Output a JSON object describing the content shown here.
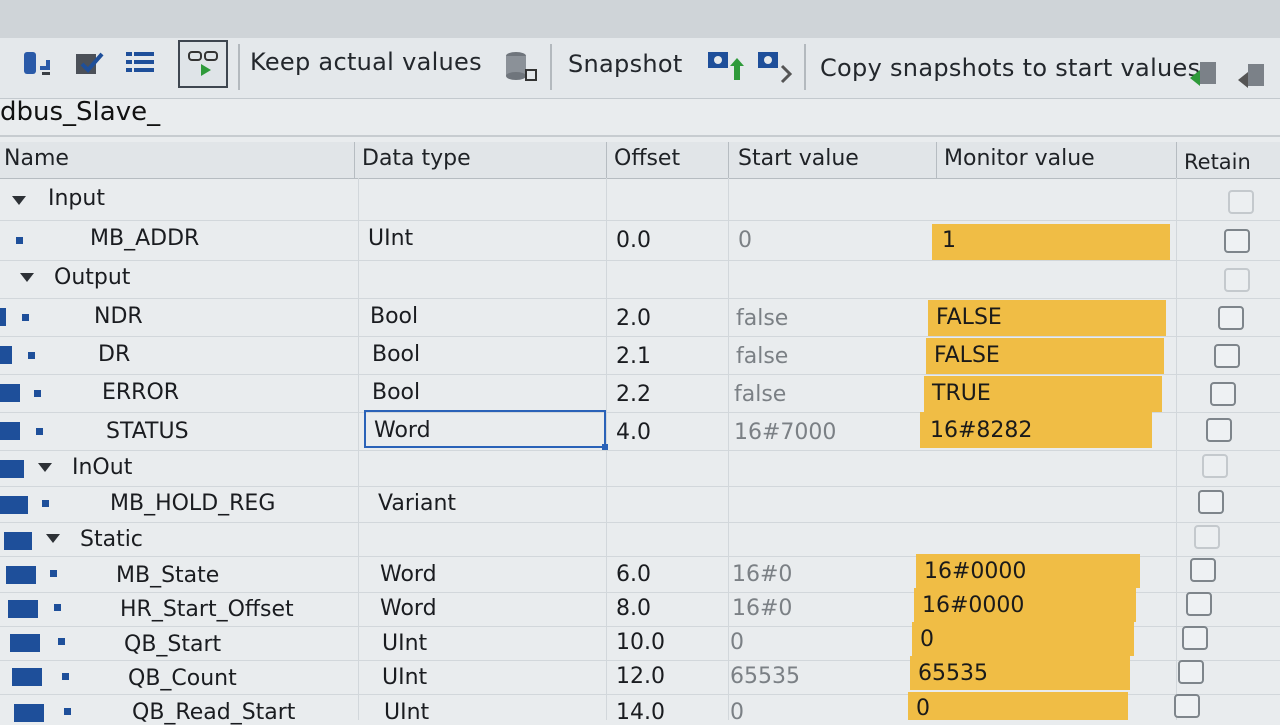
{
  "toolbar": {
    "keep_actual_values": "Keep actual values",
    "snapshot": "Snapshot",
    "copy_snapshots": "Copy snapshots to start values"
  },
  "block": {
    "title": "dbus_Slave_"
  },
  "columns": {
    "name": "Name",
    "data_type": "Data type",
    "offset": "Offset",
    "start_value": "Start value",
    "monitor_value": "Monitor value",
    "retain": "Retain"
  },
  "rows": [
    {
      "kind": "section",
      "name": "Input"
    },
    {
      "kind": "var",
      "name": "MB_ADDR",
      "type": "UInt",
      "offset": "0.0",
      "start": "0",
      "monitor": "1"
    },
    {
      "kind": "section",
      "name": "Output"
    },
    {
      "kind": "var",
      "name": "NDR",
      "type": "Bool",
      "offset": "2.0",
      "start": "false",
      "monitor": "FALSE"
    },
    {
      "kind": "var",
      "name": "DR",
      "type": "Bool",
      "offset": "2.1",
      "start": "false",
      "monitor": "FALSE"
    },
    {
      "kind": "var",
      "name": "ERROR",
      "type": "Bool",
      "offset": "2.2",
      "start": "false",
      "monitor": "TRUE"
    },
    {
      "kind": "var",
      "name": "STATUS",
      "type": "Word",
      "offset": "4.0",
      "start": "16#7000",
      "monitor": "16#8282"
    },
    {
      "kind": "section",
      "name": "InOut"
    },
    {
      "kind": "var",
      "name": "MB_HOLD_REG",
      "type": "Variant",
      "offset": "",
      "start": "",
      "monitor": ""
    },
    {
      "kind": "section",
      "name": "Static"
    },
    {
      "kind": "var",
      "name": "MB_State",
      "type": "Word",
      "offset": "6.0",
      "start": "16#0",
      "monitor": "16#0000"
    },
    {
      "kind": "var",
      "name": "HR_Start_Offset",
      "type": "Word",
      "offset": "8.0",
      "start": "16#0",
      "monitor": "16#0000"
    },
    {
      "kind": "var",
      "name": "QB_Start",
      "type": "UInt",
      "offset": "10.0",
      "start": "0",
      "monitor": "0"
    },
    {
      "kind": "var",
      "name": "QB_Count",
      "type": "UInt",
      "offset": "12.0",
      "start": "65535",
      "monitor": "65535"
    },
    {
      "kind": "var",
      "name": "QB_Read_Start",
      "type": "UInt",
      "offset": "14.0",
      "start": "0",
      "monitor": "0"
    }
  ],
  "colors": {
    "monitor_bg": "#f0bd45",
    "selection": "#2a62b8",
    "bullet": "#1e4f9a"
  },
  "icons": [
    "insert-row-icon",
    "insert-block-icon",
    "expand-all-icon",
    "monitor-all-icon",
    "keep-values-icon",
    "snapshot-save-icon",
    "snapshot-load-icon",
    "copy-start-icon",
    "copy-start-2-icon"
  ]
}
